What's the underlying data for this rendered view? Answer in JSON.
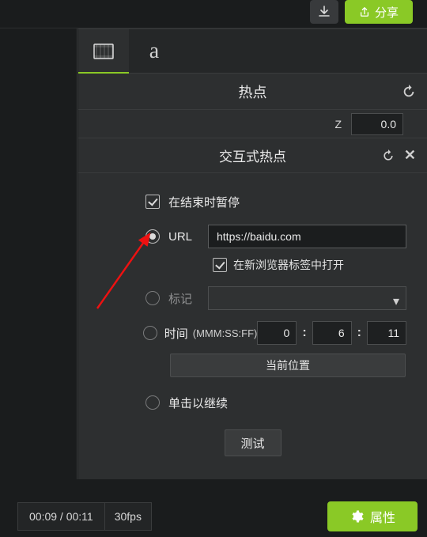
{
  "topbar": {
    "share_label": "分享"
  },
  "panel": {
    "header": "热点",
    "z_label": "Z",
    "z_value": "0.0",
    "sub_header": "交互式热点"
  },
  "form": {
    "pause_label": "在结束时暂停",
    "url_label": "URL",
    "url_value": "https://baidu.com",
    "new_tab_label": "在新浏览器标签中打开",
    "marker_label": "标记",
    "time_label": "时间",
    "time_hint": "(MMM:SS:FF)",
    "time_mm": "0",
    "time_ss": "6",
    "time_ff": "11",
    "current_pos_label": "当前位置",
    "click_continue_label": "单击以继续",
    "test_label": "测试"
  },
  "bottom": {
    "time_display": "00:09 / 00:11",
    "fps_display": "30fps",
    "properties_label": "属性"
  }
}
